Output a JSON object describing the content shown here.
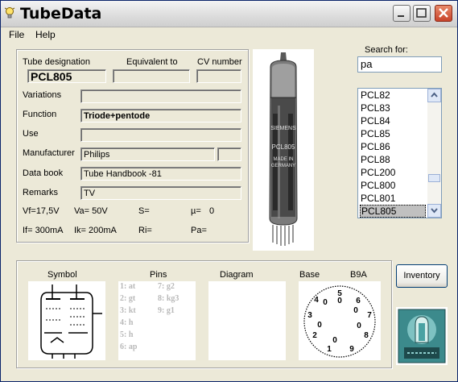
{
  "window": {
    "title": "TubeData"
  },
  "menu": [
    "File",
    "Help"
  ],
  "details": {
    "labels": {
      "designation": "Tube designation",
      "equivalent": "Equivalent to",
      "cv": "CV number",
      "variations": "Variations",
      "function": "Function",
      "use": "Use",
      "manufacturer": "Manufacturer",
      "databook": "Data book",
      "remarks": "Remarks"
    },
    "values": {
      "designation": "PCL805",
      "equivalent": "",
      "cv": "",
      "variations": "",
      "function": "Triode+pentode",
      "use": "",
      "manufacturer": "Philips",
      "manufacturer_extra": "",
      "databook": "Tube Handbook -81",
      "remarks": "TV"
    },
    "params": {
      "vf": "Vf=17,5V",
      "va": "Va= 50V",
      "s": "S=",
      "mu": "µ=",
      "mu_val": "0",
      "if": "If= 300mA",
      "ik": "Ik= 200mA",
      "ri": "Ri=",
      "pa": "Pa="
    }
  },
  "tube_photo": {
    "markings": [
      "SIEMENS",
      "PCL805",
      "MADE IN",
      "GERMANY"
    ]
  },
  "search": {
    "label": "Search for:",
    "value": "pa",
    "results": [
      "PCL82",
      "PCL83",
      "PCL84",
      "PCL85",
      "PCL86",
      "PCL88",
      "PCL200",
      "PCL800",
      "PCL801",
      "PCL805"
    ],
    "selected_index": 9
  },
  "bottom": {
    "headers": {
      "symbol": "Symbol",
      "pins": "Pins",
      "diagram": "Diagram",
      "base": "Base",
      "base_type": "B9A"
    },
    "pins_left": [
      "1: at",
      "2: gt",
      "3: kt",
      "4: h",
      "5: h",
      "6: ap"
    ],
    "pins_right": [
      "7: g2",
      "8: kg3",
      "9: g1"
    ],
    "base_pins": [
      "1",
      "2",
      "3",
      "4",
      "5",
      "6",
      "7",
      "8",
      "9",
      "0",
      "0",
      "0",
      "0",
      "0",
      "0"
    ]
  },
  "buttons": {
    "inventory": "Inventory"
  },
  "colors": {
    "title_bar": "#dcdcdc",
    "close_button": "#c8432a",
    "list_selected": "#c0c0c0"
  }
}
